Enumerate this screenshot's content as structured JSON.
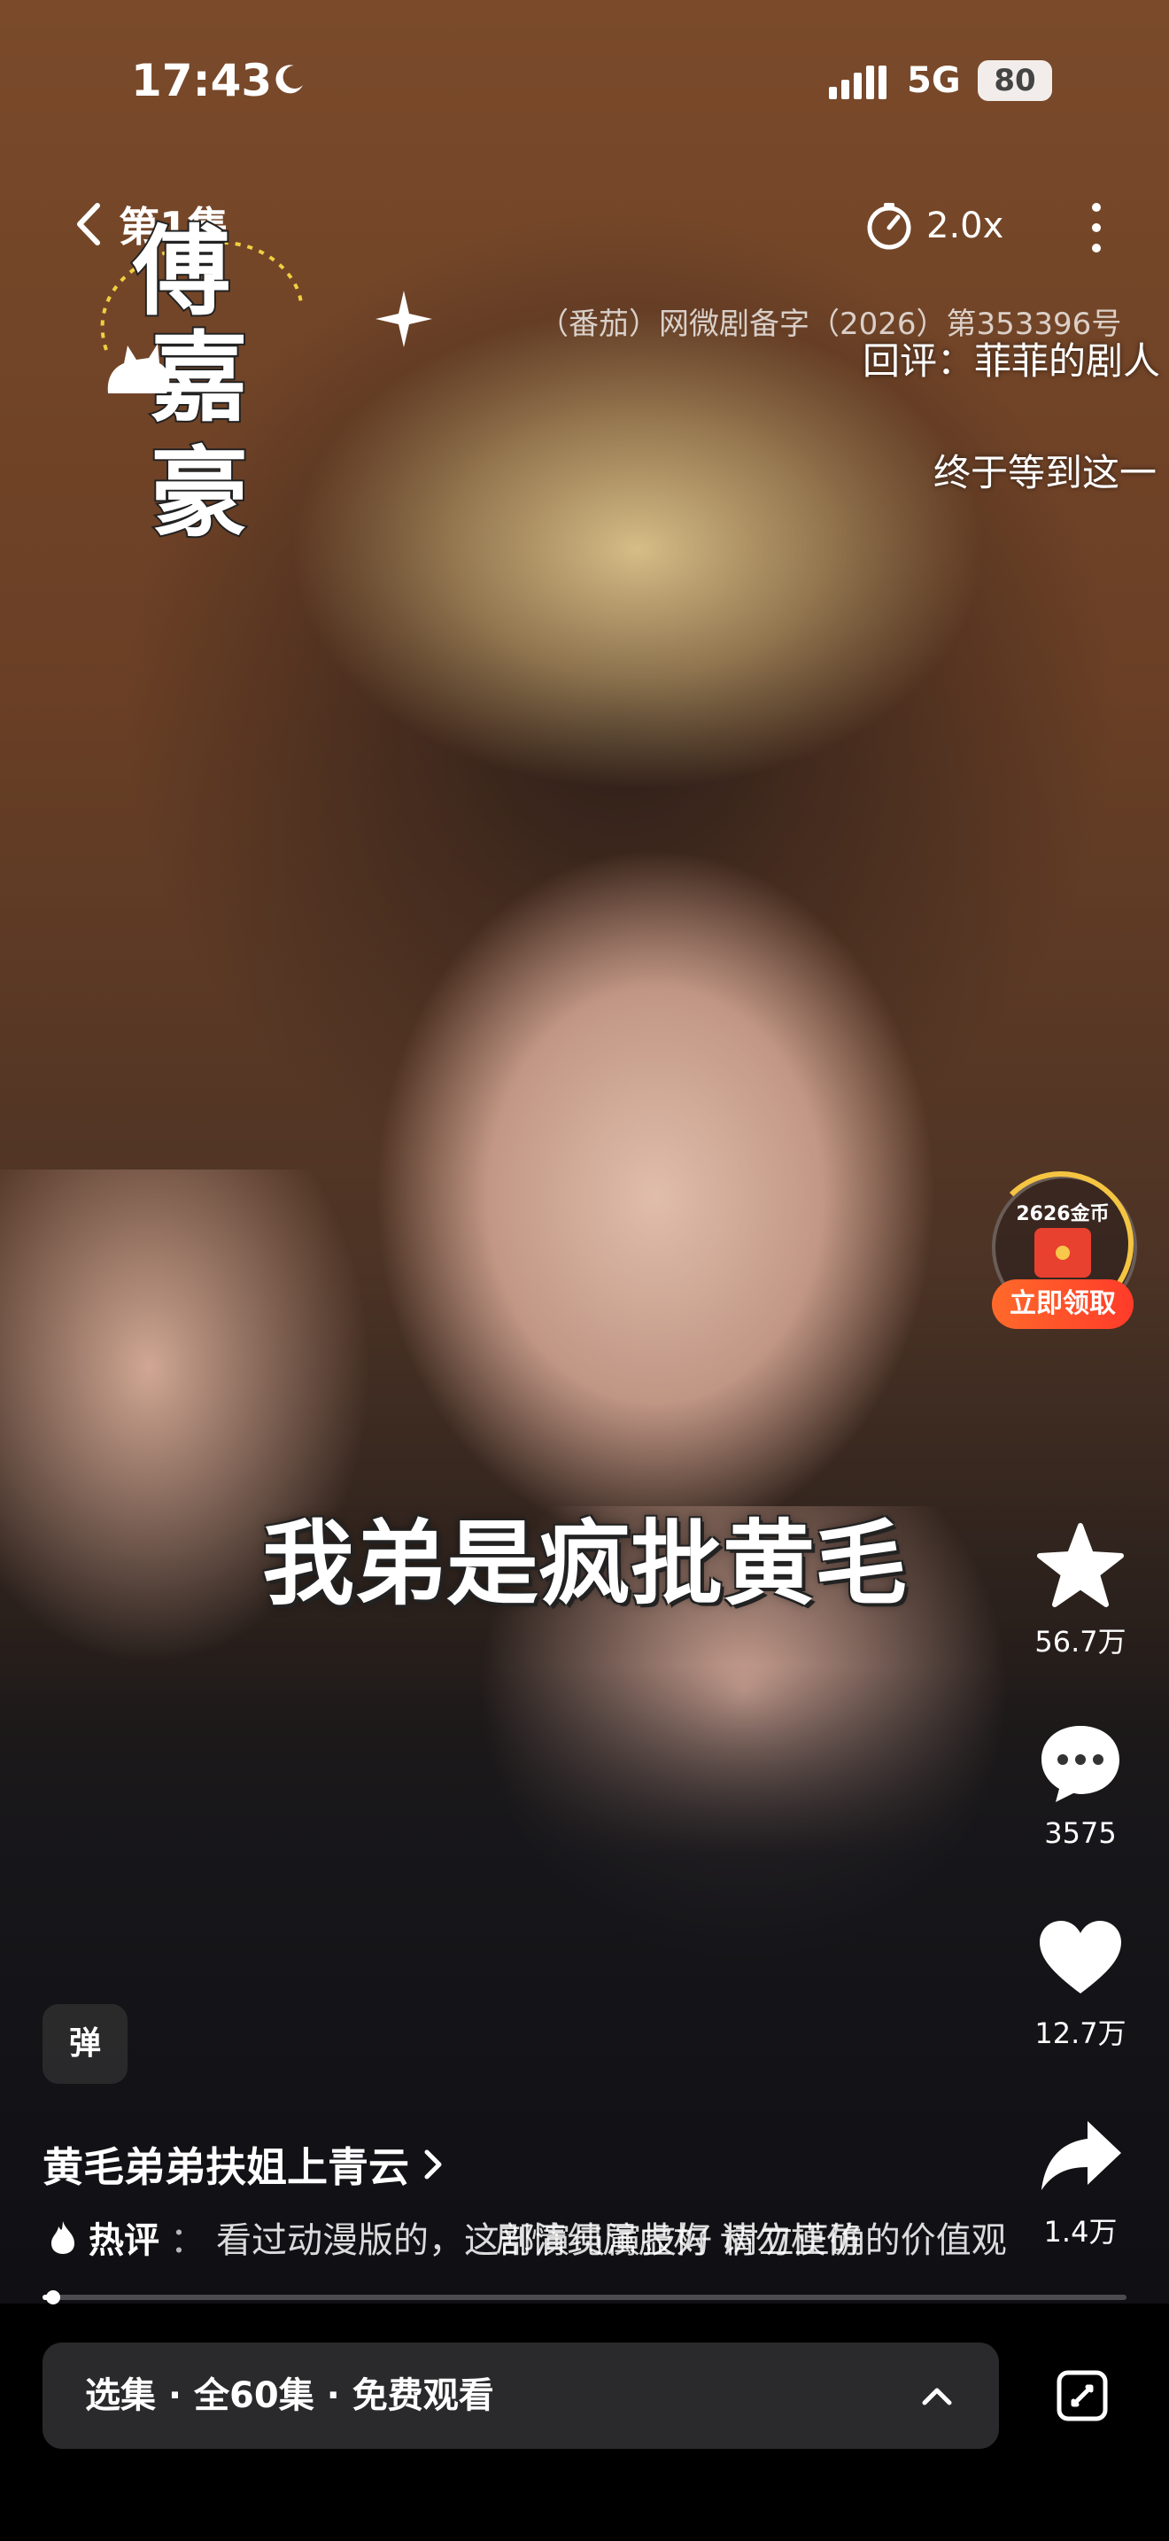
{
  "status_bar": {
    "time": "17:43",
    "network": "5G",
    "battery": "80"
  },
  "top_bar": {
    "episode": "第1集",
    "speed": "2.0x"
  },
  "overlay": {
    "logo_title": "傅嘉豪",
    "license_text": "（番茄）网微剧备字（2026）第353396号",
    "danmaku": [
      "回评：菲菲的剧人",
      "终于等到这一"
    ],
    "subtitle": "我弟是疯批黄毛",
    "notice": "剧情纯属虚构 请勿模仿"
  },
  "coin_reward": {
    "coins": "2626金币",
    "claim_label": "立即领取"
  },
  "actions": {
    "favorite_count": "56.7万",
    "comment_count": "3575",
    "like_count": "12.7万",
    "share_count": "1.4万"
  },
  "danmaku_toggle": "弹",
  "drama": {
    "title": "黄毛弟弟扶姐上青云",
    "hot_comment_label": "热评",
    "hot_comment_text": "看过动漫版的，这部演员演技好 树立正确的价值观"
  },
  "progress": {
    "value": 0.01
  },
  "episode_bar": {
    "label": "选集 · 全60集 · 免费观看"
  },
  "colors": {
    "accent": "#ff4a2a",
    "coin_ring": "#f5c542"
  },
  "icons": [
    "back-icon",
    "speed-icon",
    "more-icon",
    "star-icon",
    "comment-icon",
    "heart-icon",
    "share-icon",
    "flame-icon",
    "chevron-up-icon",
    "fullscreen-icon"
  ]
}
